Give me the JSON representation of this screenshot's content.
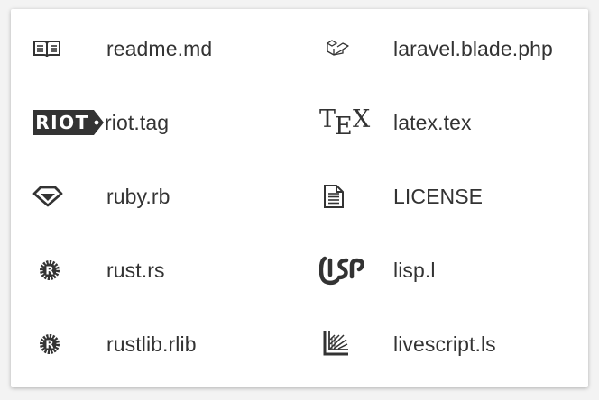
{
  "files": {
    "left": [
      {
        "name": "readme.md",
        "icon": "book-icon"
      },
      {
        "name": "riot.tag",
        "icon": "riot-icon",
        "icon_text": "RIOT"
      },
      {
        "name": "ruby.rb",
        "icon": "ruby-icon"
      },
      {
        "name": "rust.rs",
        "icon": "rust-icon"
      },
      {
        "name": "rustlib.rlib",
        "icon": "rust-icon"
      }
    ],
    "right": [
      {
        "name": "laravel.blade.php",
        "icon": "laravel-icon"
      },
      {
        "name": "latex.tex",
        "icon": "tex-icon"
      },
      {
        "name": "LICENSE",
        "icon": "document-icon"
      },
      {
        "name": "lisp.l",
        "icon": "lisp-icon"
      },
      {
        "name": "livescript.ls",
        "icon": "livescript-icon"
      }
    ]
  },
  "colors": {
    "icon": "#333333",
    "text": "#333333",
    "background": "#ffffff"
  }
}
